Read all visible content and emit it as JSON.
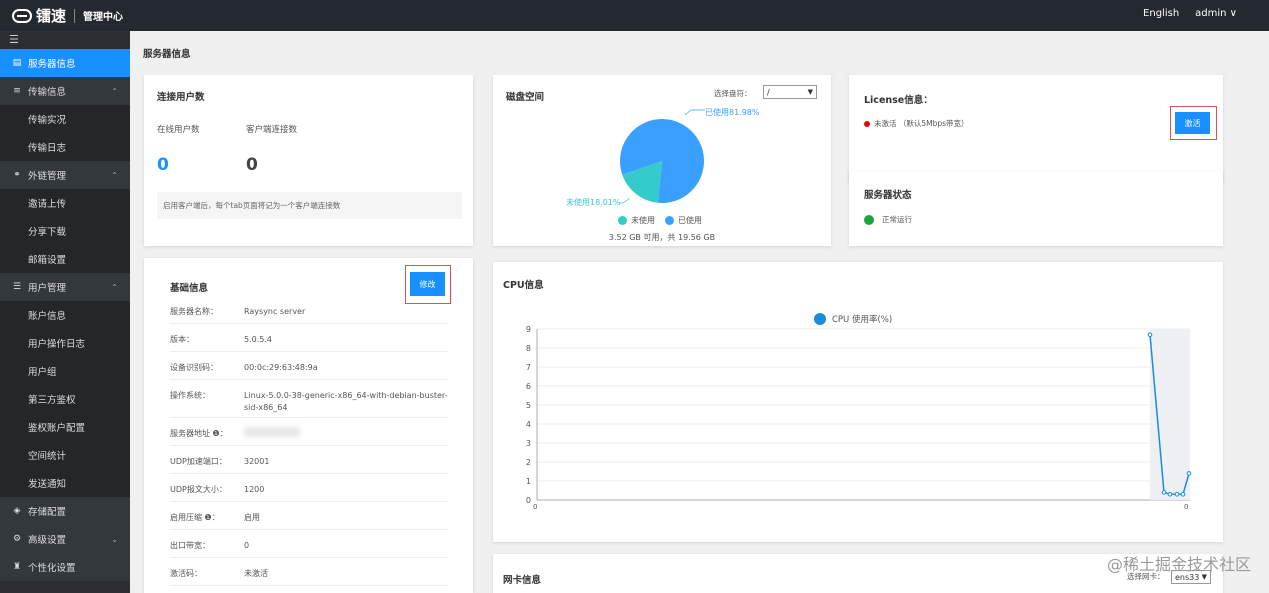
{
  "topbar": {
    "brand": "镭速",
    "title": "管理中心",
    "lang": "English",
    "user": "admin ∨"
  },
  "sidebar": {
    "items": [
      {
        "label": "服务器信息",
        "icon": "server-icon",
        "type": "active"
      },
      {
        "label": "传输信息",
        "icon": "list-icon",
        "type": "group",
        "arrow": "^"
      },
      {
        "label": "传输实况",
        "type": "sub"
      },
      {
        "label": "传输日志",
        "type": "sub"
      },
      {
        "label": "外链管理",
        "icon": "link-icon",
        "type": "group",
        "arrow": "^"
      },
      {
        "label": "邀请上传",
        "type": "sub"
      },
      {
        "label": "分享下载",
        "type": "sub"
      },
      {
        "label": "邮箱设置",
        "type": "sub"
      },
      {
        "label": "用户管理",
        "icon": "users-icon",
        "type": "group",
        "arrow": "^"
      },
      {
        "label": "账户信息",
        "type": "sub"
      },
      {
        "label": "用户操作日志",
        "type": "sub"
      },
      {
        "label": "用户组",
        "type": "sub"
      },
      {
        "label": "第三方鉴权",
        "type": "sub"
      },
      {
        "label": "鉴权账户配置",
        "type": "sub"
      },
      {
        "label": "空间统计",
        "type": "sub"
      },
      {
        "label": "发送通知",
        "type": "sub"
      },
      {
        "label": "存储配置",
        "icon": "storage-icon",
        "type": "group"
      },
      {
        "label": "高级设置",
        "icon": "gear-icon",
        "type": "group",
        "arrow": "v"
      },
      {
        "label": "个性化设置",
        "icon": "shirt-icon",
        "type": "group"
      }
    ]
  },
  "page": {
    "title": "服务器信息"
  },
  "connections": {
    "title": "连接用户数",
    "online_label": "在线用户数",
    "client_label": "客户端连接数",
    "online_value": "0",
    "client_value": "0",
    "note": "启用客户端后，每个tab页面将记为一个客户端连接数"
  },
  "disk": {
    "title": "磁盘空间",
    "select_label": "选择盘符：",
    "select_value": "/",
    "used_label": "已使用81.98%",
    "unused_label": "未使用18.01%",
    "legend_unused": "未使用",
    "legend_used": "已使用",
    "summary": "3.52 GB 可用，共 19.56 GB",
    "used_pct": 81.98,
    "unused_pct": 18.01,
    "used_color": "#3aa0ff",
    "unused_color": "#36cbcb"
  },
  "license": {
    "title": "License信息：",
    "status": "未激活 （默认5Mbps带宽）",
    "button": "激活"
  },
  "server_status": {
    "title": "服务器状态",
    "status": "正常运行"
  },
  "basic": {
    "title": "基础信息",
    "button": "修改",
    "rows": [
      {
        "k": "服务器名称：",
        "v": "Raysync server"
      },
      {
        "k": "版本：",
        "v": "5.0.5.4"
      },
      {
        "k": "设备识别码：",
        "v": "00:0c:29:63:48:9a"
      },
      {
        "k": "操作系统：",
        "v": "Linux-5.0.0-38-generic-x86_64-with-debian-buster-sid-x86_64"
      },
      {
        "k": "服务器地址 ❶：",
        "v": ""
      },
      {
        "k": "UDP加速端口：",
        "v": "32001"
      },
      {
        "k": "UDP报文大小：",
        "v": "1200"
      },
      {
        "k": "启用压缩 ❶：",
        "v": "启用"
      },
      {
        "k": "出口带宽：",
        "v": "0"
      },
      {
        "k": "激活码：",
        "v": "未激活"
      }
    ]
  },
  "cpu": {
    "title": "CPU信息",
    "legend": "CPU 使用率(%)",
    "color": "#1a8cdb"
  },
  "chart_data": {
    "type": "line",
    "title": "CPU信息",
    "series": [
      {
        "name": "CPU 使用率(%)",
        "values": [
          8.7,
          0.4,
          0.3,
          0.3,
          0.3,
          1.4
        ]
      }
    ],
    "ylim": [
      0,
      9
    ],
    "yticks": [
      "0",
      "1",
      "2",
      "3",
      "4",
      "5",
      "6",
      "7",
      "8",
      "9"
    ],
    "xtick_left": "0",
    "xtick_right": "0"
  },
  "nic": {
    "title": "网卡信息",
    "select_label": "选择网卡：",
    "select_value": "ens33"
  },
  "watermark": "@稀土掘金技术社区"
}
